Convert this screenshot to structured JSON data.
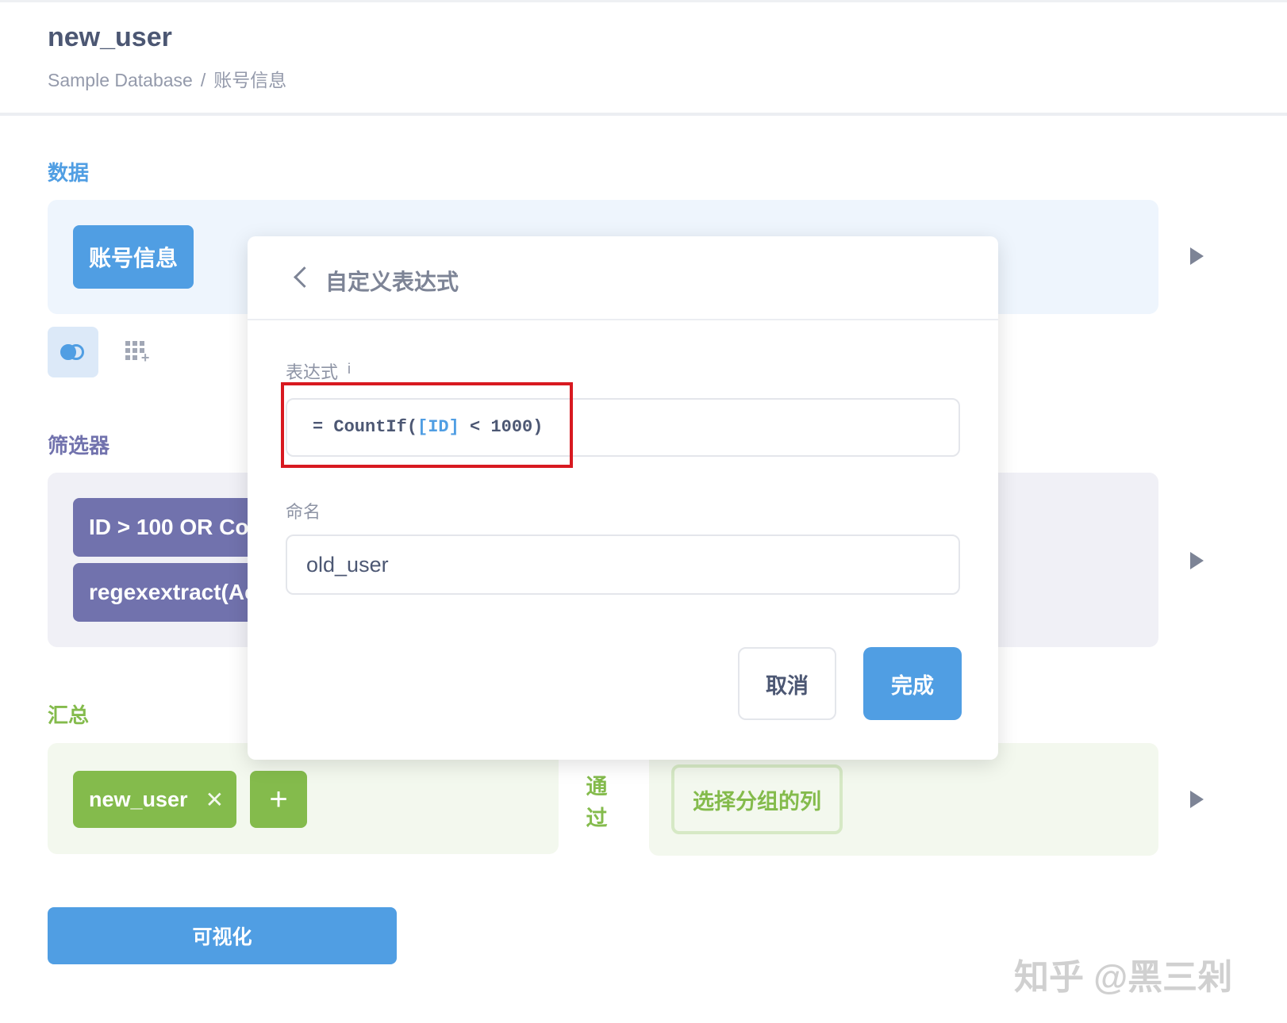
{
  "header": {
    "title": "new_user",
    "breadcrumb_db": "Sample Database",
    "breadcrumb_sep": "/",
    "breadcrumb_table": "账号信息"
  },
  "sections": {
    "data_label": "数据",
    "filter_label": "筛选器",
    "summary_label": "汇总"
  },
  "data_step": {
    "table_name": "账号信息"
  },
  "filters": [
    {
      "label": "ID > 100 OR Cou"
    },
    {
      "label": "regexextract(Ac"
    }
  ],
  "summary": {
    "metric_label": "new_user",
    "add_label": "+",
    "by_label_1": "通",
    "by_label_2": "过",
    "group_placeholder": "选择分组的列"
  },
  "visualize_label": "可视化",
  "modal": {
    "title": "自定义表达式",
    "expression_label": "表达式",
    "info_label": "i",
    "expression_prefix": "= CountIf(",
    "expression_field": "[ID]",
    "expression_suffix": " < 1000)",
    "name_label": "命名",
    "name_value": "old_user",
    "cancel_label": "取消",
    "done_label": "完成"
  },
  "watermark": "知乎 @黑三剁",
  "colors": {
    "brand": "#509ee3",
    "filter": "#7172ad",
    "summarize": "#84bb4c",
    "highlight": "#d81920"
  },
  "icons": [
    "chevron-left-icon",
    "join-icon",
    "custom-column-icon",
    "play-icon",
    "close-icon",
    "plus-icon",
    "info-icon"
  ]
}
